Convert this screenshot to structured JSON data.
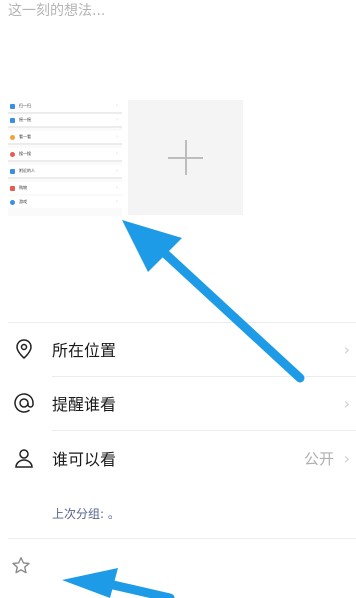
{
  "compose": {
    "placeholder": "这一刻的想法..."
  },
  "thumbnail": {
    "rows": [
      {
        "label": "扫一扫",
        "color": "#3a8ee6"
      },
      {
        "label": "摇一摇",
        "color": "#3a8ee6"
      },
      {
        "label": "看一看",
        "color": "#f1a33a"
      },
      {
        "label": "搜一搜",
        "color": "#e95b4f"
      },
      {
        "label": "附近的人",
        "color": "#3a8ee6"
      },
      {
        "label": "购物",
        "color": "#e95b4f"
      },
      {
        "label": "游戏",
        "color": "#3a8ee6"
      }
    ]
  },
  "options": {
    "location": {
      "label": "所在位置"
    },
    "remind": {
      "label": "提醒谁看"
    },
    "visibility": {
      "label": "谁可以看",
      "value": "公开"
    }
  },
  "last_group": "上次分组: 。",
  "colors": {
    "arrow": "#1e9be6"
  }
}
